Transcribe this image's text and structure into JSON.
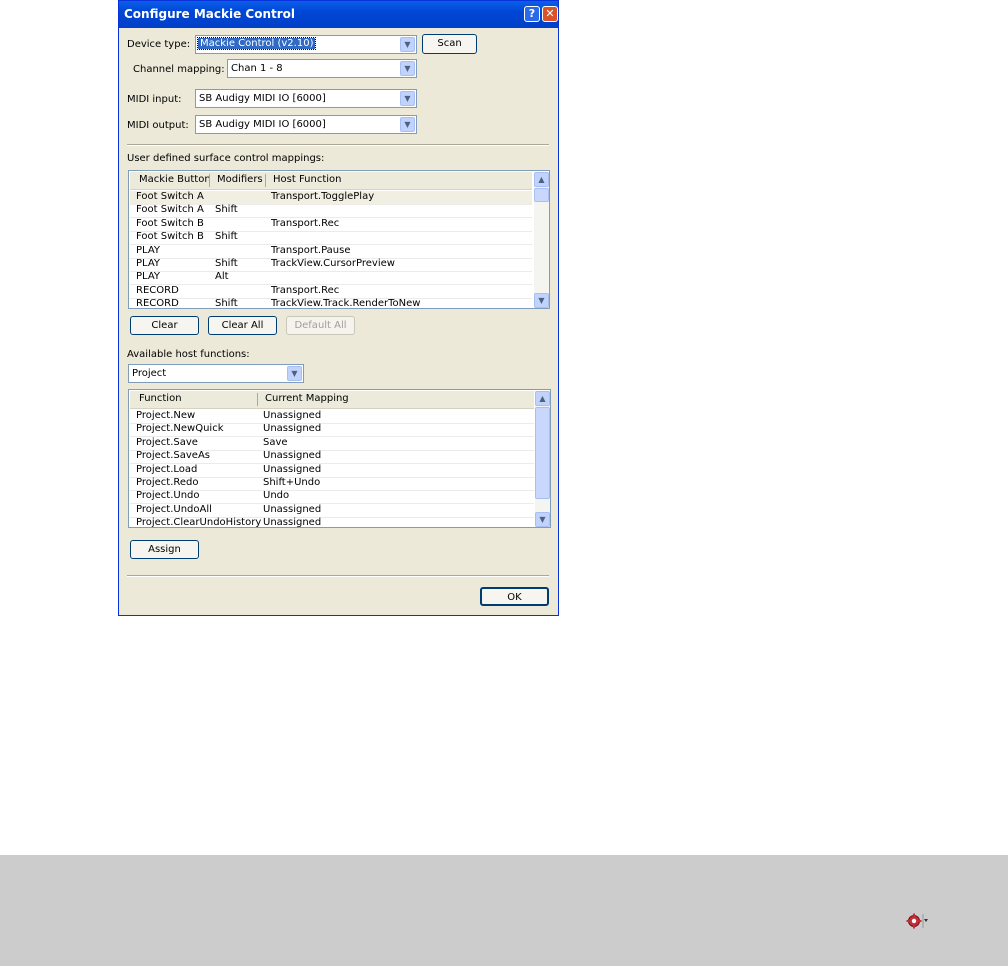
{
  "dialog": {
    "title": "Configure Mackie Control",
    "help": "?",
    "close": "✕"
  },
  "device": {
    "label": "Device type:",
    "value": "Mackie Control (v2.10)",
    "scan_label": "Scan"
  },
  "channel": {
    "label": "Channel mapping:",
    "value": "Chan 1 - 8"
  },
  "midi_input": {
    "label": "MIDI input:",
    "value": "SB Audigy MIDI IO [6000]"
  },
  "midi_output": {
    "label": "MIDI output:",
    "value": "SB Audigy MIDI IO [6000]"
  },
  "mappings": {
    "label": "User defined surface control mappings:",
    "columns": [
      "Mackie Button",
      "Modifiers",
      "Host Function"
    ],
    "rows": [
      [
        "Foot Switch A",
        "",
        "Transport.TogglePlay"
      ],
      [
        "Foot Switch A",
        "Shift",
        ""
      ],
      [
        "Foot Switch B",
        "",
        "Transport.Rec"
      ],
      [
        "Foot Switch B",
        "Shift",
        ""
      ],
      [
        "PLAY",
        "",
        "Transport.Pause"
      ],
      [
        "PLAY",
        "Shift",
        "TrackView.CursorPreview"
      ],
      [
        "PLAY",
        "Alt",
        ""
      ],
      [
        "RECORD",
        "",
        "Transport.Rec"
      ],
      [
        "RECORD",
        "Shift",
        "TrackView.Track.RenderToNew"
      ]
    ],
    "clear_label": "Clear",
    "clear_all_label": "Clear All",
    "default_all_label": "Default All"
  },
  "host": {
    "label": "Available host functions:",
    "category": "Project",
    "columns": [
      "Function",
      "Current Mapping"
    ],
    "rows": [
      [
        "Project.New",
        "Unassigned"
      ],
      [
        "Project.NewQuick",
        "Unassigned"
      ],
      [
        "Project.Save",
        "Save"
      ],
      [
        "Project.SaveAs",
        "Unassigned"
      ],
      [
        "Project.Load",
        "Unassigned"
      ],
      [
        "Project.Redo",
        "Shift+Undo"
      ],
      [
        "Project.Undo",
        "Undo"
      ],
      [
        "Project.UndoAll",
        "Unassigned"
      ],
      [
        "Project.ClearUndoHistory",
        "Unassigned"
      ]
    ],
    "assign_label": "Assign"
  },
  "ok_label": "OK",
  "icons": {
    "tray": "settings-gear-icon",
    "combo_arrow": "chevron-down-icon"
  },
  "colors": {
    "titlebar": "#0054e3",
    "dialog_bg": "#ece9d8",
    "taskbar": "#cccccc",
    "selection": "#316ac5"
  }
}
